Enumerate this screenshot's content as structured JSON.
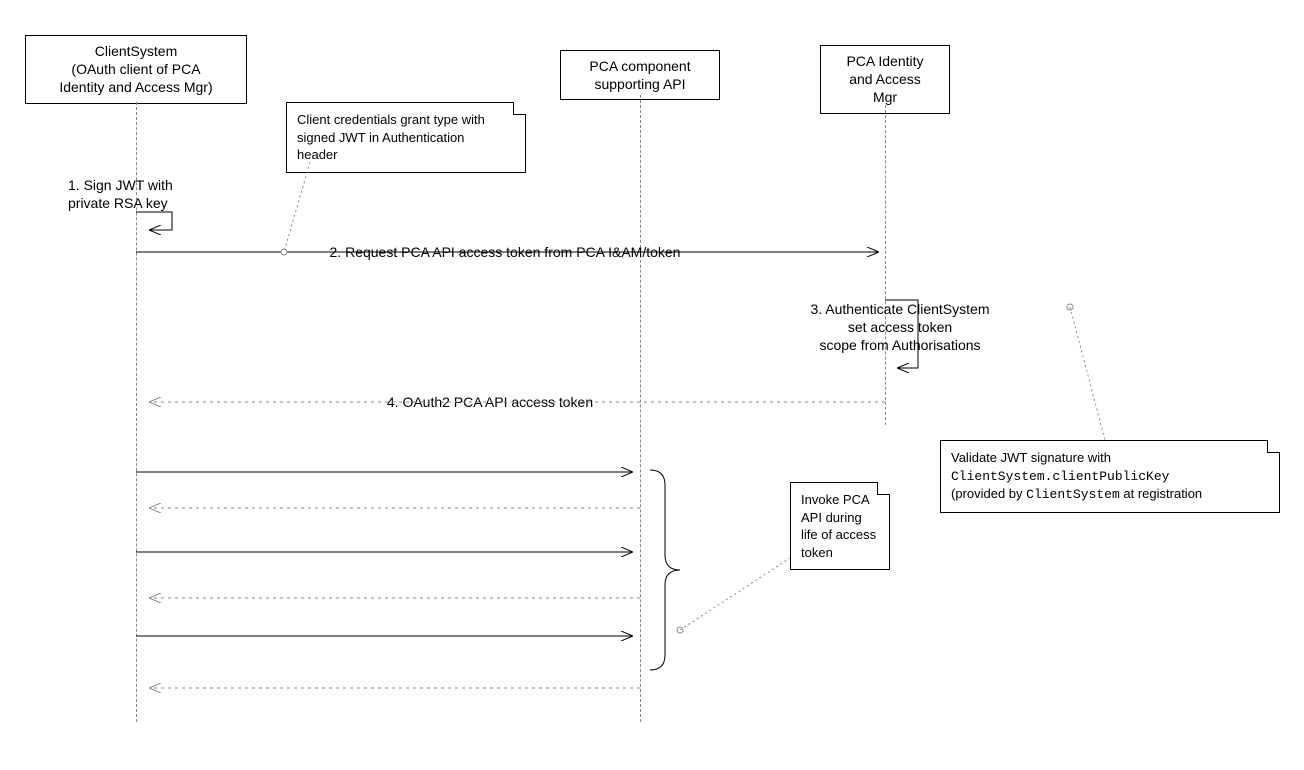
{
  "participants": {
    "client": "ClientSystem\n(OAuth client of PCA\nIdentity and Access Mgr)",
    "pcaApi": "PCA component\nsupporting API",
    "pcaIam": "PCA Identity\nand Access\nMgr"
  },
  "notes": {
    "clientCreds": "Client credentials grant type with\nsigned JWT in Authentication\nheader",
    "invoke": "Invoke PCA\nAPI during\nlife of access\ntoken",
    "validate_pre": "Validate JWT signature with\n",
    "validate_code": "ClientSystem.clientPublicKey",
    "validate_mid": "\n(provided by ",
    "validate_code2": "ClientSystem",
    "validate_post": " at registration"
  },
  "messages": {
    "m1": "1. Sign JWT with\nprivate RSA key",
    "m2": "2. Request PCA API access token from PCA I&AM/token",
    "m3": "3. Authenticate ClientSystem\nset access token\nscope from Authorisations",
    "m4": "4. OAuth2 PCA API access token"
  }
}
